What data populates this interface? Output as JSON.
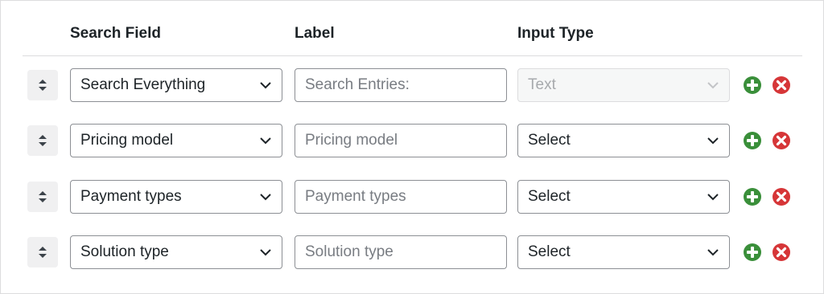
{
  "columns": {
    "search_field": "Search Field",
    "label": "Label",
    "input_type": "Input Type"
  },
  "rows": [
    {
      "search_field": "Search Everything",
      "label_placeholder": "Search Entries:",
      "input_type": "Text",
      "input_type_disabled": true
    },
    {
      "search_field": "Pricing model",
      "label_placeholder": "Pricing model",
      "input_type": "Select",
      "input_type_disabled": false
    },
    {
      "search_field": "Payment types",
      "label_placeholder": "Payment types",
      "input_type": "Select",
      "input_type_disabled": false
    },
    {
      "search_field": "Solution type",
      "label_placeholder": "Solution type",
      "input_type": "Select",
      "input_type_disabled": false
    }
  ],
  "icons": {
    "drag": "sort-arrows-icon",
    "add": "plus-circle-icon",
    "remove": "x-circle-icon"
  },
  "colors": {
    "add": "#3a8f3a",
    "remove": "#d63638",
    "handle_bg": "#f0f0f1",
    "border": "#8c8f94"
  }
}
